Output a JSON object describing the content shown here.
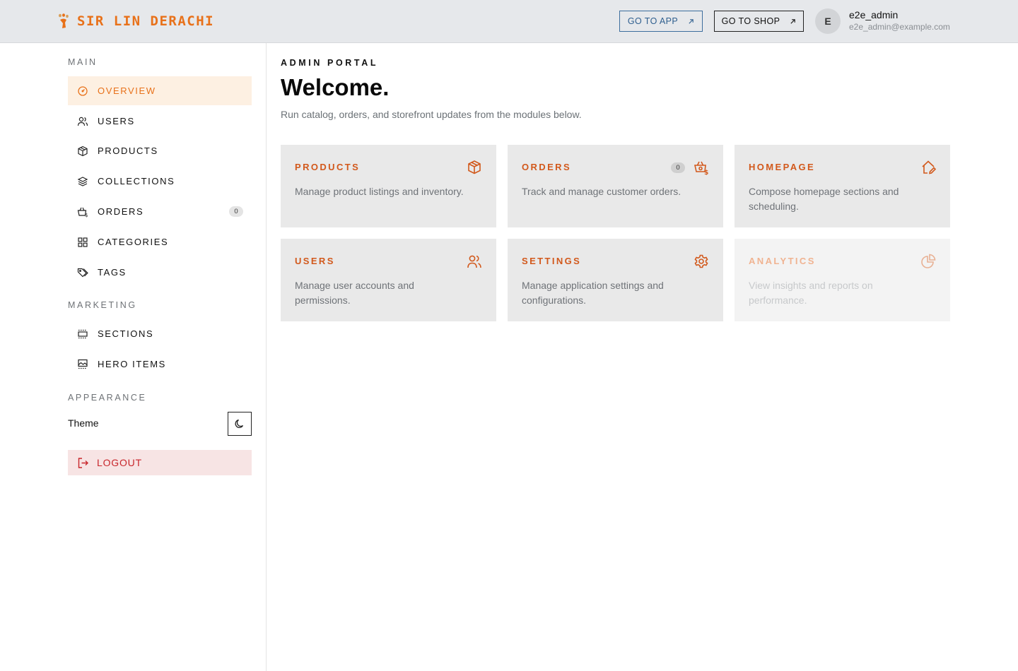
{
  "header": {
    "brand_name": "SIR LIN DERACHI",
    "go_to_app": "GO TO APP",
    "go_to_shop": "GO TO SHOP",
    "user": {
      "initial": "E",
      "name": "e2e_admin",
      "email": "e2e_admin@example.com"
    }
  },
  "sidebar": {
    "main_title": "MAIN",
    "main_items": [
      {
        "label": "OVERVIEW",
        "icon": "gauge-icon",
        "active": true
      },
      {
        "label": "USERS",
        "icon": "users-icon"
      },
      {
        "label": "PRODUCTS",
        "icon": "box-icon"
      },
      {
        "label": "COLLECTIONS",
        "icon": "layers-icon"
      },
      {
        "label": "ORDERS",
        "icon": "basket-icon",
        "count": "0"
      },
      {
        "label": "CATEGORIES",
        "icon": "grid-icon"
      },
      {
        "label": "TAGS",
        "icon": "tags-icon"
      }
    ],
    "marketing_title": "MARKETING",
    "marketing_items": [
      {
        "label": "SECTIONS",
        "icon": "sections-icon"
      },
      {
        "label": "HERO ITEMS",
        "icon": "image-icon"
      }
    ],
    "appearance_title": "APPEARANCE",
    "theme_label": "Theme",
    "theme_icon": "moon-icon",
    "logout_label": "LOGOUT"
  },
  "main": {
    "eyebrow": "ADMIN PORTAL",
    "title": "Welcome.",
    "intro": "Run catalog, orders, and storefront updates from the modules below.",
    "cards": [
      {
        "title": "PRODUCTS",
        "description": "Manage product listings and inventory.",
        "icon": "box-icon"
      },
      {
        "title": "ORDERS",
        "description": "Track and manage customer orders.",
        "icon": "basket-icon",
        "badge": "0"
      },
      {
        "title": "HOMEPAGE",
        "description": "Compose homepage sections and scheduling.",
        "icon": "home-edit-icon"
      },
      {
        "title": "USERS",
        "description": "Manage user accounts and permissions.",
        "icon": "users-icon"
      },
      {
        "title": "SETTINGS",
        "description": "Manage application settings and configurations.",
        "icon": "gear-icon"
      },
      {
        "title": "ANALYTICS",
        "description": "View insights and reports on performance.",
        "icon": "pie-chart-icon",
        "disabled": true
      }
    ]
  },
  "colors": {
    "accent": "#e8711a",
    "card_title": "#d2591c",
    "active_bg": "#fdf0e2",
    "logout": "#c8262b",
    "logout_bg": "#f7e4e4",
    "header_bg": "#e6e8eb",
    "card_bg": "#e9e9e9"
  }
}
